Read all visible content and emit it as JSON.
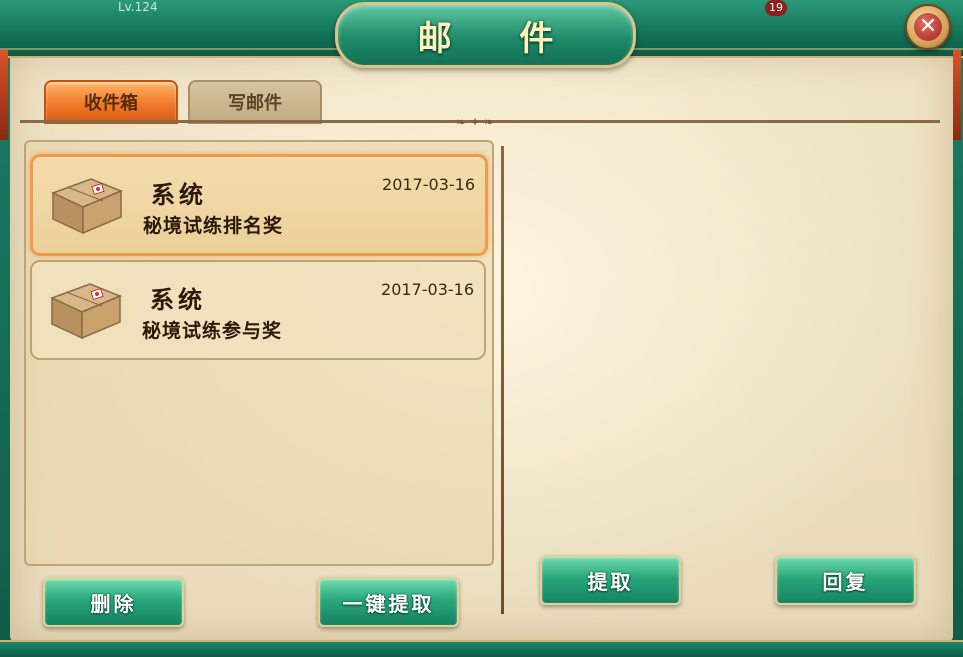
{
  "window": {
    "title": "邮 件",
    "close_icon": "close-icon"
  },
  "hud": {
    "level_text": "Lv.124",
    "badge_count": "19"
  },
  "tabs": [
    {
      "label": "收件箱",
      "active": true
    },
    {
      "label": "写邮件",
      "active": false
    }
  ],
  "mail_list": [
    {
      "sender": "系统",
      "date": "2017-03-16",
      "subject": "秘境试练排名奖",
      "icon": "package-icon",
      "selected": true
    },
    {
      "sender": "系统",
      "date": "2017-03-16",
      "subject": "秘境试练参与奖",
      "icon": "package-icon",
      "selected": false
    }
  ],
  "buttons": {
    "delete": "删除",
    "claim_all": "一键提取",
    "claim": "提取",
    "reply": "回复"
  },
  "colors": {
    "frame_green": "#137258",
    "tab_active": "#f07a2a",
    "selected_border": "#f09b4a",
    "button_green": "#2aa77b"
  }
}
